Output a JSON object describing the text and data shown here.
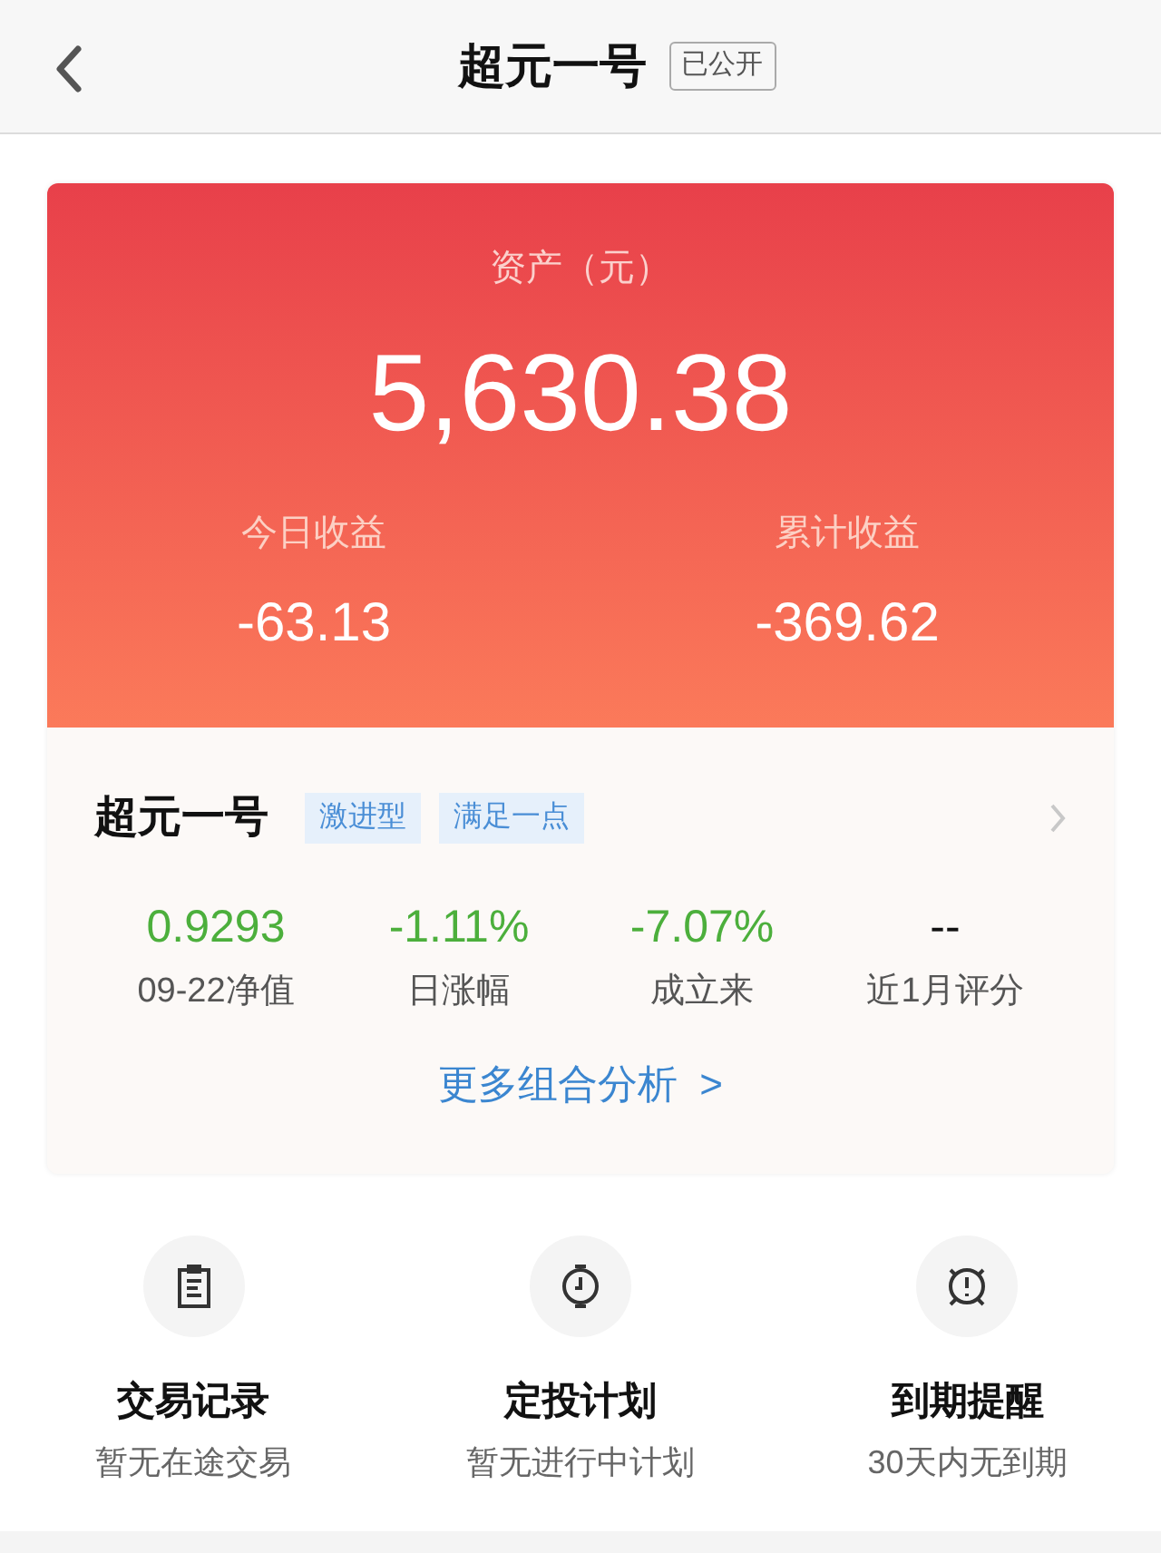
{
  "header": {
    "title": "超元一号",
    "badge": "已公开"
  },
  "assets": {
    "label": "资产（元）",
    "value": "5,630.38",
    "items": [
      {
        "label": "今日收益",
        "value": "-63.13"
      },
      {
        "label": "累计收益",
        "value": "-369.62"
      }
    ]
  },
  "portfolio": {
    "name": "超元一号",
    "tags": [
      "激进型",
      "满足一点"
    ],
    "stats": [
      {
        "value": "0.9293",
        "label": "09-22净值",
        "color": "#4caf3c"
      },
      {
        "value": "-1.11%",
        "label": "日涨幅",
        "color": "#4caf3c"
      },
      {
        "value": "-7.07%",
        "label": "成立来",
        "color": "#4caf3c"
      },
      {
        "value": "--",
        "label": "近1月评分",
        "color": "#111111"
      }
    ],
    "more_link": "更多组合分析  >"
  },
  "actions": [
    {
      "kind": "clipboard",
      "title": "交易记录",
      "subtitle": "暂无在途交易"
    },
    {
      "kind": "timer",
      "title": "定投计划",
      "subtitle": "暂无进行中计划"
    },
    {
      "kind": "alarm",
      "title": "到期提醒",
      "subtitle": "30天内无到期"
    }
  ]
}
